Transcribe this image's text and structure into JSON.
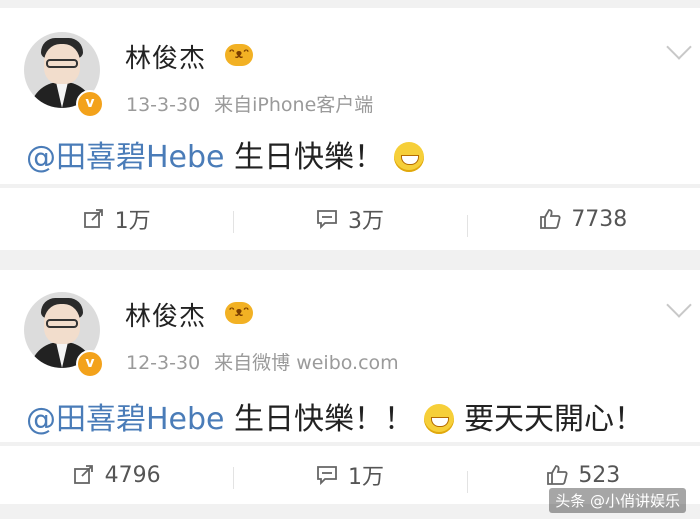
{
  "posts": [
    {
      "author": "林俊杰",
      "vip_badge": "ᵔᴥᵔ",
      "verified_badge": "v",
      "date": "13-3-30",
      "source": "来自iPhone客户端",
      "mention": "@田喜碧Hebe",
      "text": " 生日快樂！",
      "text_after_emoji": "",
      "actions": {
        "repost": "1万",
        "comment": "3万",
        "like": "7738"
      }
    },
    {
      "author": "林俊杰",
      "vip_badge": "ᵔᴥᵔ",
      "verified_badge": "v",
      "date": "12-3-30",
      "source": "来自微博 weibo.com",
      "mention": "@田喜碧Hebe",
      "text": " 生日快樂！！",
      "text_after_emoji": "要天天開心！",
      "actions": {
        "repost": "4796",
        "comment": "1万",
        "like": "523"
      }
    }
  ],
  "watermark": "头条 @小俏讲娱乐",
  "icons": [
    "repost-icon",
    "comment-icon",
    "like-icon",
    "chevron-down-icon",
    "laugh-emoji-icon"
  ],
  "colors": {
    "mention": "#4a7cb8",
    "background": "#f1f1f1",
    "verified": "#f3a21b"
  }
}
